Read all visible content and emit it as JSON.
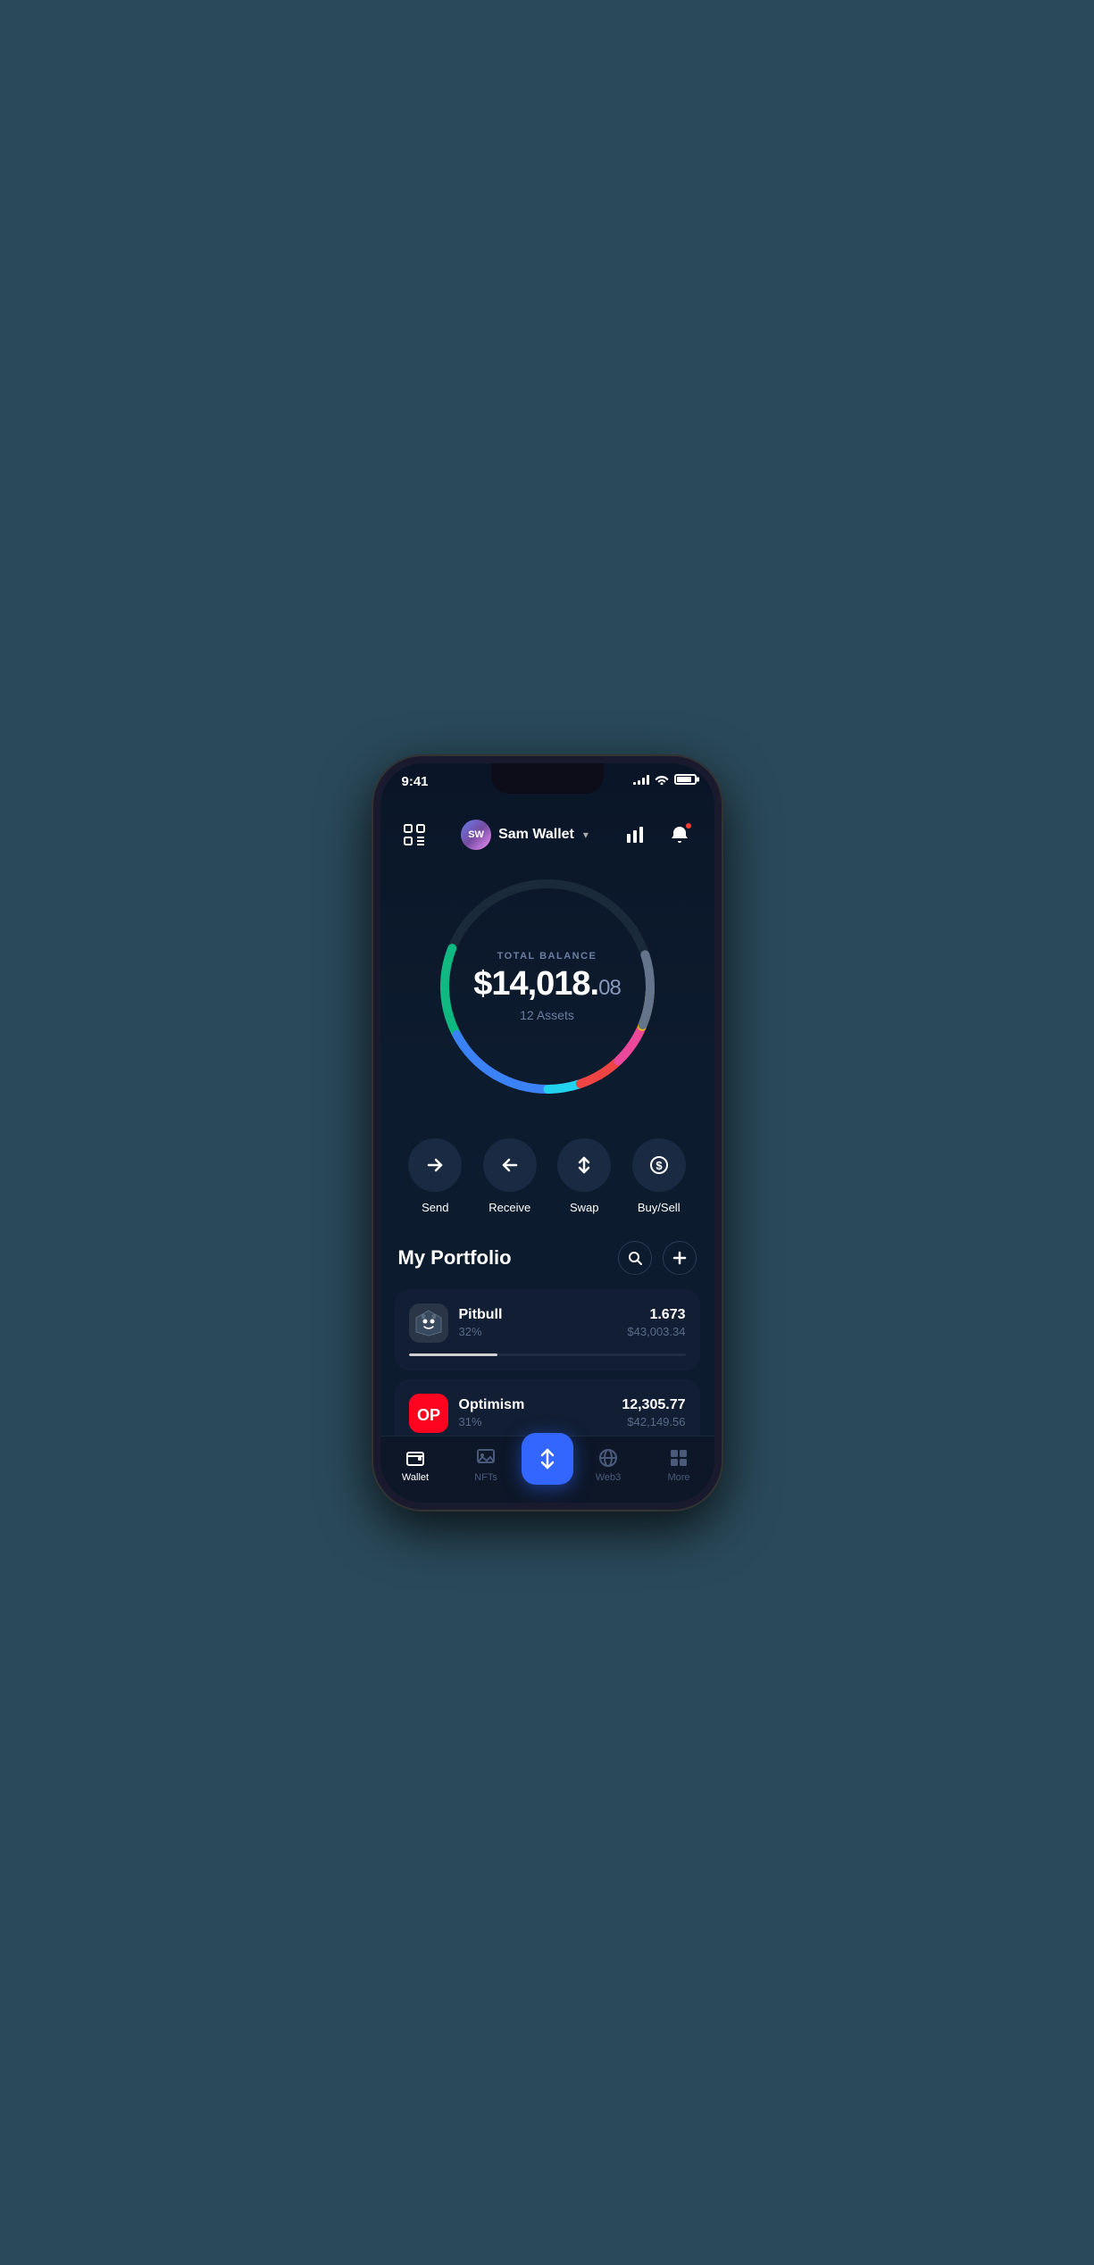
{
  "status": {
    "time": "9:41",
    "signal": [
      3,
      5,
      7,
      9,
      11
    ],
    "battery_pct": 85
  },
  "header": {
    "scan_label": "scan",
    "user_name": "Sam Wallet",
    "user_initials": "SW",
    "chevron": "▾",
    "chart_icon": "chart",
    "bell_icon": "bell"
  },
  "balance": {
    "label": "TOTAL BALANCE",
    "amount_main": "$14,018.",
    "amount_cents": "08",
    "assets_label": "12 Assets"
  },
  "actions": [
    {
      "id": "send",
      "label": "Send",
      "icon": "→"
    },
    {
      "id": "receive",
      "label": "Receive",
      "icon": "←"
    },
    {
      "id": "swap",
      "label": "Swap",
      "icon": "⇅"
    },
    {
      "id": "buysell",
      "label": "Buy/Sell",
      "icon": "$"
    }
  ],
  "portfolio": {
    "title": "My Portfolio",
    "search_icon": "search",
    "add_icon": "plus"
  },
  "assets": [
    {
      "id": "pitbull",
      "name": "Pitbull",
      "percent": "32%",
      "amount": "1.673",
      "value": "$43,003.34",
      "progress": 32,
      "progress_color": "#e0e0e0"
    },
    {
      "id": "optimism",
      "name": "Optimism",
      "percent": "31%",
      "amount": "12,305.77",
      "value": "$42,149.56",
      "progress": 31,
      "progress_color": "#ff6633"
    }
  ],
  "nav": {
    "items": [
      {
        "id": "wallet",
        "label": "Wallet",
        "active": true
      },
      {
        "id": "nfts",
        "label": "NFTs",
        "active": false
      },
      {
        "id": "center",
        "label": "",
        "active": false
      },
      {
        "id": "web3",
        "label": "Web3",
        "active": false
      },
      {
        "id": "more",
        "label": "More",
        "active": false
      }
    ]
  },
  "ring": {
    "segments": [
      {
        "color": "#00c8a0",
        "dash": 85,
        "offset": 0
      },
      {
        "color": "#3b82f6",
        "dash": 120,
        "offset": -90
      },
      {
        "color": "#22d3ee",
        "dash": 30,
        "offset": -215
      },
      {
        "color": "#ef4444",
        "dash": 40,
        "offset": -248
      },
      {
        "color": "#ec4899",
        "dash": 40,
        "offset": -292
      },
      {
        "color": "#eab308",
        "dash": 35,
        "offset": -334
      },
      {
        "color": "#94a3b8",
        "dash": 60,
        "offset": -371
      }
    ]
  }
}
